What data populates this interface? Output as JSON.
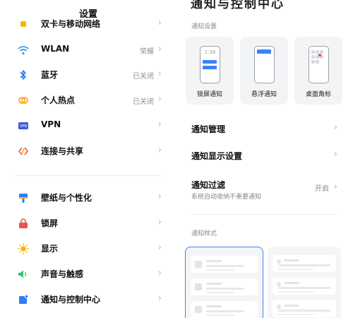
{
  "left": {
    "title": "设置",
    "items_top": [
      {
        "label": "双卡与移动网络",
        "value": "",
        "icon": "sim-card-icon",
        "color": "#f5b800"
      },
      {
        "label": "WLAN",
        "value": "荣耀",
        "icon": "wifi-icon",
        "color": "#2aa0e8"
      },
      {
        "label": "蓝牙",
        "value": "已关闭",
        "icon": "bluetooth-icon",
        "color": "#2f7cf6"
      },
      {
        "label": "个人热点",
        "value": "已关闭",
        "icon": "hotspot-icon",
        "color": "#f5a623"
      },
      {
        "label": "VPN",
        "value": "",
        "icon": "vpn-icon",
        "color": "#3b5bdb"
      },
      {
        "label": "连接与共享",
        "value": "",
        "icon": "share-icon",
        "color": "#f06449"
      }
    ],
    "items_bottom": [
      {
        "label": "壁纸与个性化",
        "value": "",
        "icon": "wallpaper-icon",
        "color": "#2f7cf6"
      },
      {
        "label": "锁屏",
        "value": "",
        "icon": "lock-icon",
        "color": "#f0504a"
      },
      {
        "label": "显示",
        "value": "",
        "icon": "sun-icon",
        "color": "#f5b800"
      },
      {
        "label": "声音与触感",
        "value": "",
        "icon": "speaker-icon",
        "color": "#34c26b"
      },
      {
        "label": "通知与控制中心",
        "value": "",
        "icon": "notification-icon",
        "color": "#2f7cf6"
      }
    ]
  },
  "right": {
    "cut_title": "通知与控制中心",
    "notify_settings_label": "通知设置",
    "cards": [
      {
        "label": "锁屏通知",
        "clock": "2:36"
      },
      {
        "label": "悬浮通知"
      },
      {
        "label": "桌面角标"
      }
    ],
    "rows": [
      {
        "label": "通知管理",
        "value": "",
        "sub": ""
      },
      {
        "label": "通知显示设置",
        "value": "",
        "sub": ""
      },
      {
        "label": "通知过滤",
        "value": "开启",
        "sub": "系统自动收纳不重要通知"
      }
    ],
    "style_label": "通知样式"
  },
  "colors": {
    "accent": "#3b82f6",
    "badge_red": "#e5484d"
  }
}
